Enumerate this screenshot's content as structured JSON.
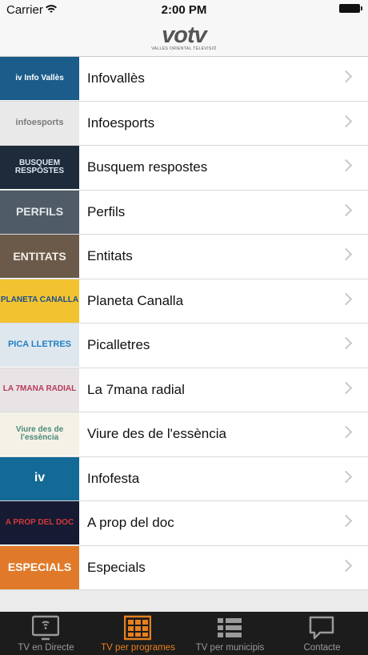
{
  "status": {
    "carrier": "Carrier",
    "time": "2:00 PM"
  },
  "header": {
    "logo_text": "votv",
    "logo_subtitle": "VALLÈS ORIENTAL TELEVISIÓ"
  },
  "programs": [
    {
      "label": "Infovallès",
      "thumb_text": "iv Info Vallès",
      "bg": "#1b5c8a",
      "fg": "#ffffff"
    },
    {
      "label": "Infoesports",
      "thumb_text": "infoesports",
      "bg": "#e9e9e9",
      "fg": "#7a7a7a"
    },
    {
      "label": "Busquem respostes",
      "thumb_text": "BUSQUEM RESPOSTES",
      "bg": "#1e2b3a",
      "fg": "#dce6f0"
    },
    {
      "label": "Perfils",
      "thumb_text": "PERFILS",
      "bg": "#4f5b66",
      "fg": "#e4e8ec"
    },
    {
      "label": "Entitats",
      "thumb_text": "ENTITATS",
      "bg": "#6b5a4a",
      "fg": "#f2efe8"
    },
    {
      "label": "Planeta Canalla",
      "thumb_text": "PLANETA CANALLA",
      "bg": "#f2c230",
      "fg": "#1a4f8a"
    },
    {
      "label": "Picalletres",
      "thumb_text": "PICA LLETRES",
      "bg": "#dfe7ee",
      "fg": "#1f7fc4"
    },
    {
      "label": "La 7mana radial",
      "thumb_text": "LA 7MANA RADIAL",
      "bg": "#e8e4e6",
      "fg": "#b83a5a"
    },
    {
      "label": "Viure des de l'essència",
      "thumb_text": "Viure des de l'essència",
      "bg": "#f4f1e6",
      "fg": "#4a8a7a"
    },
    {
      "label": "Infofesta",
      "thumb_text": "iv",
      "bg": "#136a96",
      "fg": "#ffffff"
    },
    {
      "label": "A prop del doc",
      "thumb_text": "A PROP DEL DOC",
      "bg": "#161a33",
      "fg": "#d03a3a"
    },
    {
      "label": "Especials",
      "thumb_text": "ESPECIALS",
      "bg": "#e07a2a",
      "fg": "#ffffff"
    }
  ],
  "tabs": [
    {
      "label": "TV en Directe",
      "icon": "tv-icon"
    },
    {
      "label": "TV per programes",
      "icon": "grid-icon"
    },
    {
      "label": "TV per municipis",
      "icon": "list-icon"
    },
    {
      "label": "Contacte",
      "icon": "chat-bubble-icon"
    }
  ],
  "colors": {
    "accent": "#e8801e",
    "tab_inactive": "#9a9a9a",
    "tabbar_bg": "#1c1c1c",
    "chevron": "#c7c7cc"
  },
  "active_tab": "TV per programes"
}
